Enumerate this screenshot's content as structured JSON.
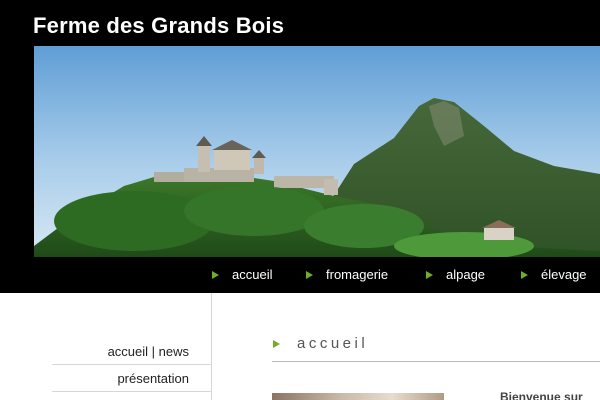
{
  "site": {
    "title": "Ferme des Grands Bois"
  },
  "banner": {
    "image": "landscape-castle-mountain"
  },
  "nav": {
    "items": [
      {
        "label": "accueil"
      },
      {
        "label": "fromagerie"
      },
      {
        "label": "alpage"
      },
      {
        "label": "élevage"
      }
    ]
  },
  "sidebar": {
    "items": [
      {
        "label": "accueil | news"
      },
      {
        "label": "présentation"
      }
    ]
  },
  "content": {
    "title": "accueil",
    "intro": "Bienvenue sur"
  },
  "colors": {
    "accent": "#6fae2a",
    "header_bg": "#000000"
  }
}
